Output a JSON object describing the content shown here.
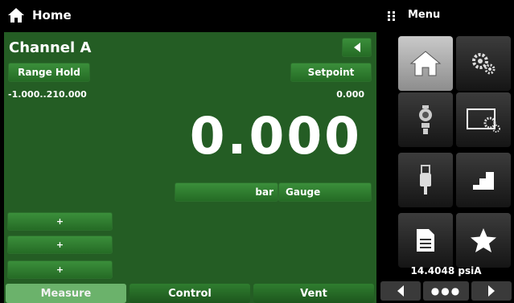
{
  "topbar": {
    "home_icon": "home-icon",
    "title": "Home",
    "menu_icon": "grip-icon",
    "menu_title": "Menu"
  },
  "channel": {
    "name": "Channel A",
    "back_icon": "back-arrow-icon",
    "range_hold_label": "Range Hold",
    "setpoint_label": "Setpoint",
    "range": "-1.000..210.000",
    "setpoint_value": "0.000",
    "reading": "0.000",
    "unit": "bar",
    "mode": "Gauge",
    "plus_buttons": [
      "+",
      "+",
      "+"
    ]
  },
  "tabs": [
    {
      "label": "Measure",
      "active": true
    },
    {
      "label": "Control",
      "active": false
    },
    {
      "label": "Vent",
      "active": false
    }
  ],
  "menu": {
    "tiles": [
      {
        "icon": "home-icon",
        "active": true
      },
      {
        "icon": "gears-icon",
        "active": false
      },
      {
        "icon": "sensor-icon",
        "active": false
      },
      {
        "icon": "display-settings-icon",
        "active": false
      },
      {
        "icon": "usb-icon",
        "active": false
      },
      {
        "icon": "steps-icon",
        "active": false
      },
      {
        "icon": "document-icon",
        "active": false
      },
      {
        "icon": "star-icon",
        "active": false
      }
    ],
    "barometer": "14.4048 psiA",
    "page_dots": "●●●"
  },
  "colors": {
    "panel_green": "#245d24",
    "button_green": "#2f7d2f",
    "active_tab": "#6bb26b",
    "tile_gray": "#2a2a2a"
  }
}
